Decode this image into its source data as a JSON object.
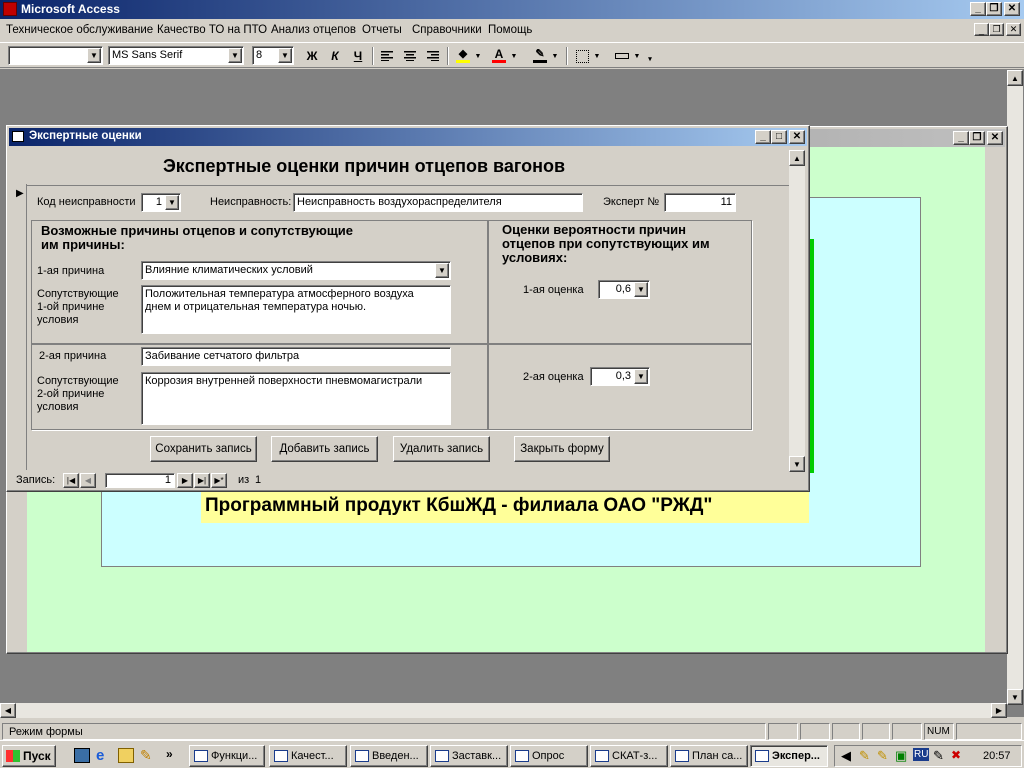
{
  "app": {
    "title": "Microsoft Access",
    "menu": [
      "Техническое обслуживание",
      "Качество ТО на ПТО",
      "Анализ отцепов",
      "Отчеты",
      "Справочники",
      "Помощь"
    ],
    "status_text": "Режим формы",
    "status_num": "NUM"
  },
  "toolbar": {
    "object_select": "",
    "font_name": "MS Sans Serif",
    "font_size": "8",
    "bold": "Ж",
    "italic": "К",
    "underline": "Ч"
  },
  "background_form": {
    "banner": "Программный продукт КбшЖД - филиала ОАО \"РЖД\""
  },
  "form": {
    "window_title": "Экспертные оценки",
    "heading": "Экспертные оценки причин отцепов вагонов",
    "fault_code_label": "Код неисправности",
    "fault_code_value": "1",
    "fault_label": "Неисправность:",
    "fault_value": "Неисправность воздухораспределителя",
    "expert_label": "Эксперт №",
    "expert_value": "11",
    "causes_title_1": "Возможные причины отцепов и сопутствующие",
    "causes_title_2": "им причины:",
    "cause1_label": "1-ая причина",
    "cause1_value": "Влияние климатических условий",
    "cond1_label_1": "Сопутствующие",
    "cond1_label_2": "1-ой причине",
    "cond1_label_3": "условия",
    "cond1_value_1": "Положительная температура атмосферного воздуха",
    "cond1_value_2": "днем и отрицательная температура ночью.",
    "cause2_label": "2-ая причина",
    "cause2_value": "Забивание сетчатого фильтра",
    "cond2_label_1": "Сопутствующие",
    "cond2_label_2": "2-ой причине",
    "cond2_label_3": "условия",
    "cond2_value": "Коррозия внутренней поверхности пневмомагистрали",
    "scores_title_1": "Оценки вероятности причин",
    "scores_title_2": "отцепов при сопутствующих им",
    "scores_title_3": "условиях:",
    "score1_label": "1-ая оценка",
    "score1_value": "0,6",
    "score2_label": "2-ая оценка",
    "score2_value": "0,3",
    "buttons": {
      "save": "Сохранить запись",
      "add": "Добавить запись",
      "delete": "Удалить запись",
      "close": "Закрыть форму"
    },
    "nav": {
      "record_label": "Запись:",
      "current": "1",
      "of_label": "из",
      "total": "1"
    }
  },
  "taskbar": {
    "start": "Пуск",
    "tasks": [
      "Функци...",
      "Качест...",
      "Введен...",
      "Заставк...",
      "Опрос",
      "СКАТ-з...",
      "План са...",
      "Экспер..."
    ],
    "lang": "RU",
    "clock": "20:57"
  },
  "colors": {
    "title_active": "#0a246a",
    "title_gradient_end": "#a6caf0",
    "title_inactive": "#808080",
    "face": "#d4d0c8",
    "bg_form": "#ccffcc",
    "bg_inner": "#ccffff",
    "banner_bg": "#ffff99"
  }
}
